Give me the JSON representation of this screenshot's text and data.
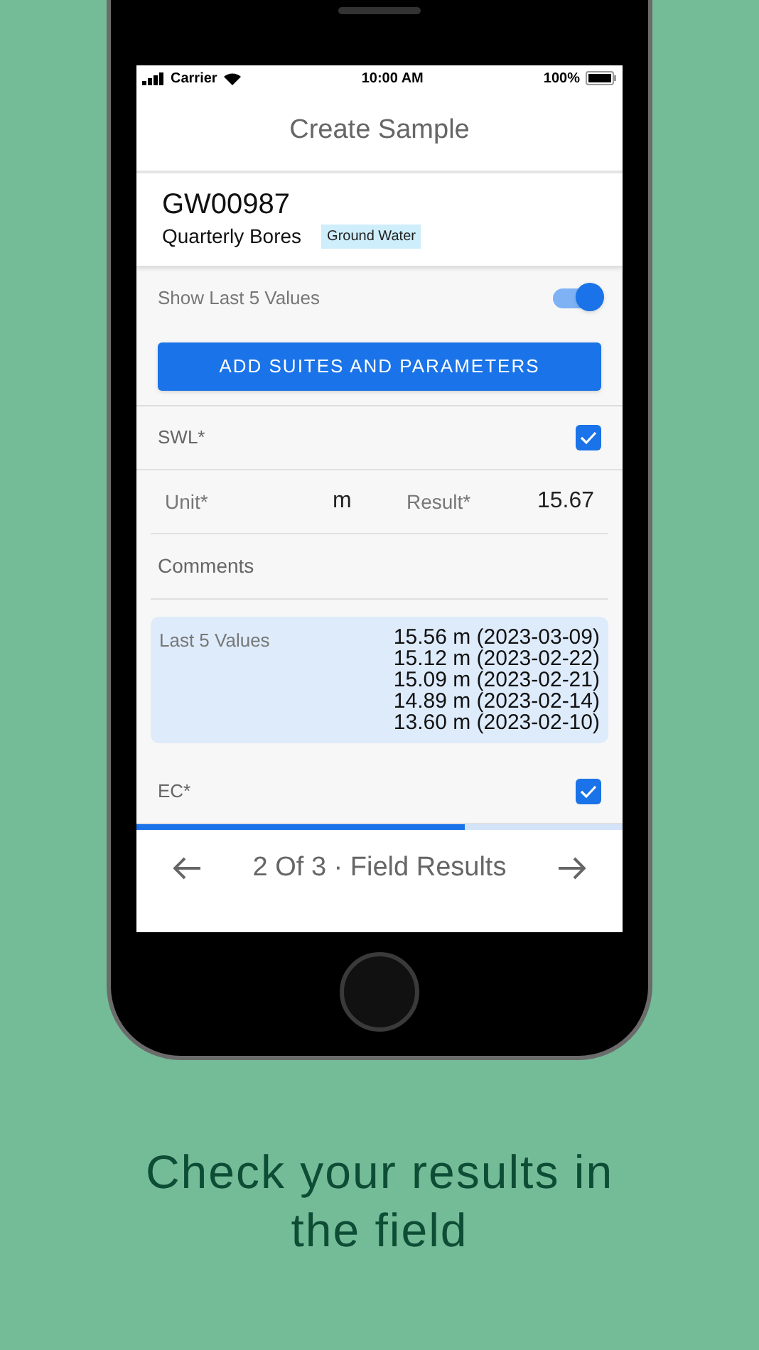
{
  "status_bar": {
    "carrier": "Carrier",
    "time": "10:00 AM",
    "battery": "100%"
  },
  "header": {
    "title": "Create Sample"
  },
  "sample": {
    "id": "GW00987",
    "group": "Quarterly Bores",
    "tag": "Ground Water"
  },
  "toggle": {
    "label": "Show Last 5 Values",
    "on": true
  },
  "add_button": {
    "label": "ADD SUITES AND PARAMETERS"
  },
  "parameters": [
    {
      "name": "SWL*",
      "checked": true,
      "unit_label": "Unit*",
      "unit": "m",
      "result_label": "Result*",
      "result": "15.67",
      "comments_placeholder": "Comments",
      "history": {
        "label": "Last 5 Values",
        "values": [
          "15.56 m (2023-03-09)",
          "15.12 m (2023-02-22)",
          "15.09 m (2023-02-21)",
          "14.89 m (2023-02-14)",
          "13.60 m (2023-02-10)"
        ]
      }
    },
    {
      "name": "EC*",
      "checked": true
    }
  ],
  "progress": {
    "level": 0.675
  },
  "pager": {
    "text": "2 Of 3 · Field Results"
  },
  "tagline": "Check your results in the field"
}
